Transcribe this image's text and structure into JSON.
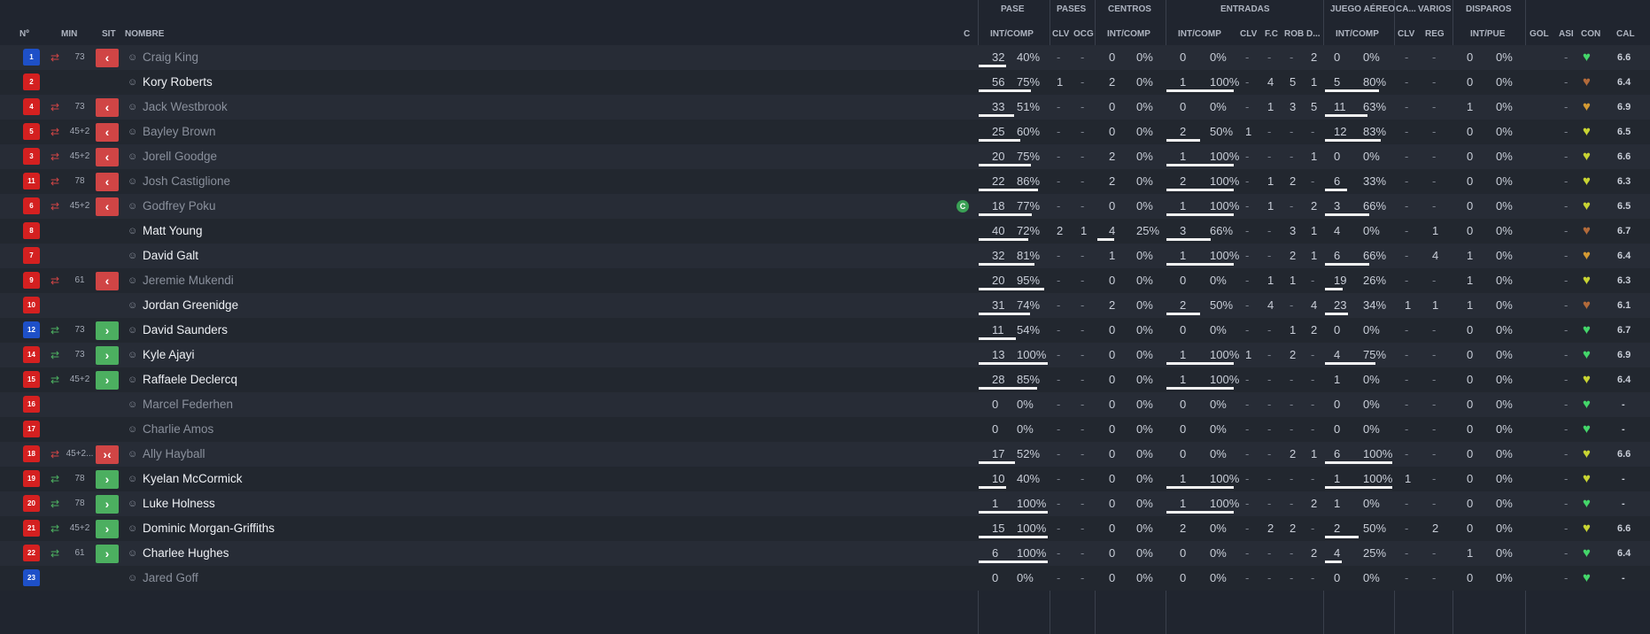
{
  "headers": {
    "num": "Nº",
    "min": "MIN",
    "sit": "SIT",
    "name": "NOMBRE",
    "c": "C",
    "pase_group": "PASE",
    "pase_col": "INT/COMP",
    "pases_group": "PASES",
    "clv": "CLV",
    "ocg": "OCG",
    "centros_group": "CENTROS",
    "centros_col": "INT/COMP",
    "entradas_group": "ENTRADAS",
    "entradas_col": "INT/COMP",
    "ent_clv": "CLV",
    "fc": "F.C",
    "rob": "ROB",
    "d": "D...",
    "aereo_group": "JUEGO AÉREO",
    "aereo_col": "INT/COMP",
    "ca_group": "CA...",
    "ca_clv": "CLV",
    "varios_group": "VARIOS",
    "reg": "REG",
    "disparos_group": "DISPAROS",
    "disparos_col": "INT/PUE",
    "gol": "GOL",
    "asi": "ASI",
    "con": "CON",
    "cal": "CAL"
  },
  "colors": {
    "accent_out": "#d04545",
    "accent_in": "#4caf60",
    "shirt_red": "#d42020",
    "shirt_blue": "#1e50c8"
  },
  "players": [
    {
      "num": "1",
      "kit": "blue",
      "sub": "swap",
      "min": "73",
      "sit": "out",
      "name": "Craig King",
      "active": false,
      "pase_i": "32",
      "pase_p": "40%",
      "pase_b": 0.4,
      "clv": "-",
      "ocg": "-",
      "cen_i": "0",
      "cen_p": "0%",
      "cen_b": 0,
      "ent_i": "0",
      "ent_p": "0%",
      "ent_b": 0,
      "eclv": "-",
      "fc": "-",
      "rob": "-",
      "d": "2",
      "aer_i": "0",
      "aer_p": "0%",
      "aer_b": 0,
      "caclv": "-",
      "reg": "-",
      "dis_i": "0",
      "dis_p": "0%",
      "dis_b": 0,
      "gol": "",
      "asi": "-",
      "con": "green",
      "cal": "6.6"
    },
    {
      "num": "2",
      "kit": "red",
      "sub": "",
      "min": "",
      "sit": "",
      "name": "Kory Roberts",
      "active": true,
      "pase_i": "56",
      "pase_p": "75%",
      "pase_b": 0.75,
      "clv": "1",
      "ocg": "-",
      "cen_i": "2",
      "cen_p": "0%",
      "cen_b": 0,
      "ent_i": "1",
      "ent_p": "100%",
      "ent_b": 1,
      "eclv": "-",
      "fc": "4",
      "rob": "5",
      "d": "1",
      "aer_i": "5",
      "aer_p": "80%",
      "aer_b": 0.8,
      "caclv": "-",
      "reg": "-",
      "dis_i": "0",
      "dis_p": "0%",
      "dis_b": 0,
      "gol": "",
      "asi": "-",
      "con": "brown",
      "cal": "6.4"
    },
    {
      "num": "4",
      "kit": "red",
      "sub": "swap",
      "min": "73",
      "sit": "out",
      "name": "Jack Westbrook",
      "active": false,
      "pase_i": "33",
      "pase_p": "51%",
      "pase_b": 0.51,
      "clv": "-",
      "ocg": "-",
      "cen_i": "0",
      "cen_p": "0%",
      "cen_b": 0,
      "ent_i": "0",
      "ent_p": "0%",
      "ent_b": 0,
      "eclv": "-",
      "fc": "1",
      "rob": "3",
      "d": "5",
      "aer_i": "11",
      "aer_p": "63%",
      "aer_b": 0.63,
      "caclv": "-",
      "reg": "-",
      "dis_i": "1",
      "dis_p": "0%",
      "dis_b": 0,
      "gol": "",
      "asi": "-",
      "con": "orange",
      "cal": "6.9"
    },
    {
      "num": "5",
      "kit": "red",
      "sub": "swap",
      "min": "45+2",
      "sit": "out",
      "name": "Bayley Brown",
      "active": false,
      "pase_i": "25",
      "pase_p": "60%",
      "pase_b": 0.6,
      "clv": "-",
      "ocg": "-",
      "cen_i": "0",
      "cen_p": "0%",
      "cen_b": 0,
      "ent_i": "2",
      "ent_p": "50%",
      "ent_b": 0.5,
      "eclv": "1",
      "fc": "-",
      "rob": "-",
      "d": "-",
      "aer_i": "12",
      "aer_p": "83%",
      "aer_b": 0.83,
      "caclv": "-",
      "reg": "-",
      "dis_i": "0",
      "dis_p": "0%",
      "dis_b": 0,
      "gol": "",
      "asi": "-",
      "con": "yellow",
      "cal": "6.5"
    },
    {
      "num": "3",
      "kit": "red",
      "sub": "swap",
      "min": "45+2",
      "sit": "out",
      "name": "Jorell Goodge",
      "active": false,
      "pase_i": "20",
      "pase_p": "75%",
      "pase_b": 0.75,
      "clv": "-",
      "ocg": "-",
      "cen_i": "2",
      "cen_p": "0%",
      "cen_b": 0,
      "ent_i": "1",
      "ent_p": "100%",
      "ent_b": 1,
      "eclv": "-",
      "fc": "-",
      "rob": "-",
      "d": "1",
      "aer_i": "0",
      "aer_p": "0%",
      "aer_b": 0,
      "caclv": "-",
      "reg": "-",
      "dis_i": "0",
      "dis_p": "0%",
      "dis_b": 0,
      "gol": "",
      "asi": "-",
      "con": "yellow",
      "cal": "6.6"
    },
    {
      "num": "11",
      "kit": "red",
      "sub": "swap",
      "min": "78",
      "sit": "out",
      "name": "Josh Castiglione",
      "active": false,
      "pase_i": "22",
      "pase_p": "86%",
      "pase_b": 0.86,
      "clv": "-",
      "ocg": "-",
      "cen_i": "2",
      "cen_p": "0%",
      "cen_b": 0,
      "ent_i": "2",
      "ent_p": "100%",
      "ent_b": 1,
      "eclv": "-",
      "fc": "1",
      "rob": "2",
      "d": "-",
      "aer_i": "6",
      "aer_p": "33%",
      "aer_b": 0.33,
      "caclv": "-",
      "reg": "-",
      "dis_i": "0",
      "dis_p": "0%",
      "dis_b": 0,
      "gol": "",
      "asi": "-",
      "con": "yellow",
      "cal": "6.3"
    },
    {
      "num": "6",
      "kit": "red",
      "sub": "swap",
      "min": "45+2",
      "sit": "out",
      "name": "Godfrey Poku",
      "active": false,
      "captain": "C",
      "pase_i": "18",
      "pase_p": "77%",
      "pase_b": 0.77,
      "clv": "-",
      "ocg": "-",
      "cen_i": "0",
      "cen_p": "0%",
      "cen_b": 0,
      "ent_i": "1",
      "ent_p": "100%",
      "ent_b": 1,
      "eclv": "-",
      "fc": "1",
      "rob": "-",
      "d": "2",
      "aer_i": "3",
      "aer_p": "66%",
      "aer_b": 0.66,
      "caclv": "-",
      "reg": "-",
      "dis_i": "0",
      "dis_p": "0%",
      "dis_b": 0,
      "gol": "",
      "asi": "-",
      "con": "yellow",
      "cal": "6.5"
    },
    {
      "num": "8",
      "kit": "red",
      "sub": "",
      "min": "",
      "sit": "",
      "name": "Matt Young",
      "active": true,
      "pase_i": "40",
      "pase_p": "72%",
      "pase_b": 0.72,
      "clv": "2",
      "ocg": "1",
      "cen_i": "4",
      "cen_p": "25%",
      "cen_b": 0.25,
      "ent_i": "3",
      "ent_p": "66%",
      "ent_b": 0.66,
      "eclv": "-",
      "fc": "-",
      "rob": "3",
      "d": "1",
      "aer_i": "4",
      "aer_p": "0%",
      "aer_b": 0,
      "caclv": "-",
      "reg": "1",
      "dis_i": "0",
      "dis_p": "0%",
      "dis_b": 0,
      "gol": "",
      "asi": "-",
      "con": "brown",
      "cal": "6.7"
    },
    {
      "num": "7",
      "kit": "red",
      "sub": "",
      "min": "",
      "sit": "",
      "name": "David Galt",
      "active": true,
      "pase_i": "32",
      "pase_p": "81%",
      "pase_b": 0.81,
      "clv": "-",
      "ocg": "-",
      "cen_i": "1",
      "cen_p": "0%",
      "cen_b": 0,
      "ent_i": "1",
      "ent_p": "100%",
      "ent_b": 1,
      "eclv": "-",
      "fc": "-",
      "rob": "2",
      "d": "1",
      "aer_i": "6",
      "aer_p": "66%",
      "aer_b": 0.66,
      "caclv": "-",
      "reg": "4",
      "dis_i": "1",
      "dis_p": "0%",
      "dis_b": 0,
      "gol": "",
      "asi": "-",
      "con": "orange",
      "cal": "6.4"
    },
    {
      "num": "9",
      "kit": "red",
      "sub": "swap",
      "min": "61",
      "sit": "out",
      "name": "Jeremie Mukendi",
      "active": false,
      "pase_i": "20",
      "pase_p": "95%",
      "pase_b": 0.95,
      "clv": "-",
      "ocg": "-",
      "cen_i": "0",
      "cen_p": "0%",
      "cen_b": 0,
      "ent_i": "0",
      "ent_p": "0%",
      "ent_b": 0,
      "eclv": "-",
      "fc": "1",
      "rob": "1",
      "d": "-",
      "aer_i": "19",
      "aer_p": "26%",
      "aer_b": 0.26,
      "caclv": "-",
      "reg": "-",
      "dis_i": "1",
      "dis_p": "0%",
      "dis_b": 0,
      "gol": "",
      "asi": "-",
      "con": "yellow",
      "cal": "6.3"
    },
    {
      "num": "10",
      "kit": "red",
      "sub": "",
      "min": "",
      "sit": "",
      "name": "Jordan Greenidge",
      "active": true,
      "pase_i": "31",
      "pase_p": "74%",
      "pase_b": 0.74,
      "clv": "-",
      "ocg": "-",
      "cen_i": "2",
      "cen_p": "0%",
      "cen_b": 0,
      "ent_i": "2",
      "ent_p": "50%",
      "ent_b": 0.5,
      "eclv": "-",
      "fc": "4",
      "rob": "-",
      "d": "4",
      "aer_i": "23",
      "aer_p": "34%",
      "aer_b": 0.34,
      "caclv": "1",
      "reg": "1",
      "dis_i": "1",
      "dis_p": "0%",
      "dis_b": 0,
      "gol": "",
      "asi": "-",
      "con": "brown",
      "cal": "6.1"
    },
    {
      "num": "12",
      "kit": "blue",
      "sub": "swapin",
      "min": "73",
      "sit": "in",
      "name": "David Saunders",
      "active": true,
      "pase_i": "11",
      "pase_p": "54%",
      "pase_b": 0.54,
      "clv": "-",
      "ocg": "-",
      "cen_i": "0",
      "cen_p": "0%",
      "cen_b": 0,
      "ent_i": "0",
      "ent_p": "0%",
      "ent_b": 0,
      "eclv": "-",
      "fc": "-",
      "rob": "1",
      "d": "2",
      "aer_i": "0",
      "aer_p": "0%",
      "aer_b": 0,
      "caclv": "-",
      "reg": "-",
      "dis_i": "0",
      "dis_p": "0%",
      "dis_b": 0,
      "gol": "",
      "asi": "-",
      "con": "green",
      "cal": "6.7"
    },
    {
      "num": "14",
      "kit": "red",
      "sub": "swapin",
      "min": "73",
      "sit": "in",
      "name": "Kyle Ajayi",
      "active": true,
      "pase_i": "13",
      "pase_p": "100%",
      "pase_b": 1,
      "clv": "-",
      "ocg": "-",
      "cen_i": "0",
      "cen_p": "0%",
      "cen_b": 0,
      "ent_i": "1",
      "ent_p": "100%",
      "ent_b": 1,
      "eclv": "1",
      "fc": "-",
      "rob": "2",
      "d": "-",
      "aer_i": "4",
      "aer_p": "75%",
      "aer_b": 0.75,
      "caclv": "-",
      "reg": "-",
      "dis_i": "0",
      "dis_p": "0%",
      "dis_b": 0,
      "gol": "",
      "asi": "-",
      "con": "green",
      "cal": "6.9"
    },
    {
      "num": "15",
      "kit": "red",
      "sub": "swapin",
      "min": "45+2",
      "sit": "in",
      "name": "Raffaele Declercq",
      "active": true,
      "pase_i": "28",
      "pase_p": "85%",
      "pase_b": 0.85,
      "clv": "-",
      "ocg": "-",
      "cen_i": "0",
      "cen_p": "0%",
      "cen_b": 0,
      "ent_i": "1",
      "ent_p": "100%",
      "ent_b": 1,
      "eclv": "-",
      "fc": "-",
      "rob": "-",
      "d": "-",
      "aer_i": "1",
      "aer_p": "0%",
      "aer_b": 0,
      "caclv": "-",
      "reg": "-",
      "dis_i": "0",
      "dis_p": "0%",
      "dis_b": 0,
      "gol": "",
      "asi": "-",
      "con": "yellow",
      "cal": "6.4"
    },
    {
      "num": "16",
      "kit": "red",
      "sub": "",
      "min": "",
      "sit": "",
      "name": "Marcel Federhen",
      "active": false,
      "pase_i": "0",
      "pase_p": "0%",
      "pase_b": 0,
      "clv": "-",
      "ocg": "-",
      "cen_i": "0",
      "cen_p": "0%",
      "cen_b": 0,
      "ent_i": "0",
      "ent_p": "0%",
      "ent_b": 0,
      "eclv": "-",
      "fc": "-",
      "rob": "-",
      "d": "-",
      "aer_i": "0",
      "aer_p": "0%",
      "aer_b": 0,
      "caclv": "-",
      "reg": "-",
      "dis_i": "0",
      "dis_p": "0%",
      "dis_b": 0,
      "gol": "",
      "asi": "-",
      "con": "green",
      "cal": "-"
    },
    {
      "num": "17",
      "kit": "red",
      "sub": "",
      "min": "",
      "sit": "",
      "name": "Charlie Amos",
      "active": false,
      "pase_i": "0",
      "pase_p": "0%",
      "pase_b": 0,
      "clv": "-",
      "ocg": "-",
      "cen_i": "0",
      "cen_p": "0%",
      "cen_b": 0,
      "ent_i": "0",
      "ent_p": "0%",
      "ent_b": 0,
      "eclv": "-",
      "fc": "-",
      "rob": "-",
      "d": "-",
      "aer_i": "0",
      "aer_p": "0%",
      "aer_b": 0,
      "caclv": "-",
      "reg": "-",
      "dis_i": "0",
      "dis_p": "0%",
      "dis_b": 0,
      "gol": "",
      "asi": "-",
      "con": "green",
      "cal": "-"
    },
    {
      "num": "18",
      "kit": "red",
      "sub": "swap",
      "min": "45+2...",
      "sit": "both",
      "name": "Ally Hayball",
      "active": false,
      "pase_i": "17",
      "pase_p": "52%",
      "pase_b": 0.52,
      "clv": "-",
      "ocg": "-",
      "cen_i": "0",
      "cen_p": "0%",
      "cen_b": 0,
      "ent_i": "0",
      "ent_p": "0%",
      "ent_b": 0,
      "eclv": "-",
      "fc": "-",
      "rob": "2",
      "d": "1",
      "aer_i": "6",
      "aer_p": "100%",
      "aer_b": 1,
      "caclv": "-",
      "reg": "-",
      "dis_i": "0",
      "dis_p": "0%",
      "dis_b": 0,
      "gol": "",
      "asi": "-",
      "con": "yellow",
      "cal": "6.6"
    },
    {
      "num": "19",
      "kit": "red",
      "sub": "swapin",
      "min": "78",
      "sit": "in",
      "name": "Kyelan McCormick",
      "active": true,
      "pase_i": "10",
      "pase_p": "40%",
      "pase_b": 0.4,
      "clv": "-",
      "ocg": "-",
      "cen_i": "0",
      "cen_p": "0%",
      "cen_b": 0,
      "ent_i": "1",
      "ent_p": "100%",
      "ent_b": 1,
      "eclv": "-",
      "fc": "-",
      "rob": "-",
      "d": "-",
      "aer_i": "1",
      "aer_p": "100%",
      "aer_b": 1,
      "caclv": "1",
      "reg": "-",
      "dis_i": "0",
      "dis_p": "0%",
      "dis_b": 0,
      "gol": "",
      "asi": "-",
      "con": "yellow",
      "cal": "-"
    },
    {
      "num": "20",
      "kit": "red",
      "sub": "swapin",
      "min": "78",
      "sit": "in",
      "name": "Luke Holness",
      "active": true,
      "pase_i": "1",
      "pase_p": "100%",
      "pase_b": 1,
      "clv": "-",
      "ocg": "-",
      "cen_i": "0",
      "cen_p": "0%",
      "cen_b": 0,
      "ent_i": "1",
      "ent_p": "100%",
      "ent_b": 1,
      "eclv": "-",
      "fc": "-",
      "rob": "-",
      "d": "2",
      "aer_i": "1",
      "aer_p": "0%",
      "aer_b": 0,
      "caclv": "-",
      "reg": "-",
      "dis_i": "0",
      "dis_p": "0%",
      "dis_b": 0,
      "gol": "",
      "asi": "-",
      "con": "green",
      "cal": "-"
    },
    {
      "num": "21",
      "kit": "red",
      "sub": "swapin",
      "min": "45+2",
      "sit": "in",
      "name": "Dominic Morgan-Griffiths",
      "active": true,
      "pase_i": "15",
      "pase_p": "100%",
      "pase_b": 1,
      "clv": "-",
      "ocg": "-",
      "cen_i": "0",
      "cen_p": "0%",
      "cen_b": 0,
      "ent_i": "2",
      "ent_p": "0%",
      "ent_b": 0,
      "eclv": "-",
      "fc": "2",
      "rob": "2",
      "d": "-",
      "aer_i": "2",
      "aer_p": "50%",
      "aer_b": 0.5,
      "caclv": "-",
      "reg": "2",
      "dis_i": "0",
      "dis_p": "0%",
      "dis_b": 0,
      "gol": "",
      "asi": "-",
      "con": "yellow",
      "cal": "6.6"
    },
    {
      "num": "22",
      "kit": "red",
      "sub": "swapin",
      "min": "61",
      "sit": "in",
      "name": "Charlee Hughes",
      "active": true,
      "pase_i": "6",
      "pase_p": "100%",
      "pase_b": 1,
      "clv": "-",
      "ocg": "-",
      "cen_i": "0",
      "cen_p": "0%",
      "cen_b": 0,
      "ent_i": "0",
      "ent_p": "0%",
      "ent_b": 0,
      "eclv": "-",
      "fc": "-",
      "rob": "-",
      "d": "2",
      "aer_i": "4",
      "aer_p": "25%",
      "aer_b": 0.25,
      "caclv": "-",
      "reg": "-",
      "dis_i": "1",
      "dis_p": "0%",
      "dis_b": 0,
      "gol": "",
      "asi": "-",
      "con": "green",
      "cal": "6.4"
    },
    {
      "num": "23",
      "kit": "blue",
      "sub": "",
      "min": "",
      "sit": "",
      "name": "Jared Goff",
      "active": false,
      "pase_i": "0",
      "pase_p": "0%",
      "pase_b": 0,
      "clv": "-",
      "ocg": "-",
      "cen_i": "0",
      "cen_p": "0%",
      "cen_b": 0,
      "ent_i": "0",
      "ent_p": "0%",
      "ent_b": 0,
      "eclv": "-",
      "fc": "-",
      "rob": "-",
      "d": "-",
      "aer_i": "0",
      "aer_p": "0%",
      "aer_b": 0,
      "caclv": "-",
      "reg": "-",
      "dis_i": "0",
      "dis_p": "0%",
      "dis_b": 0,
      "gol": "",
      "asi": "-",
      "con": "green",
      "cal": "-"
    }
  ]
}
